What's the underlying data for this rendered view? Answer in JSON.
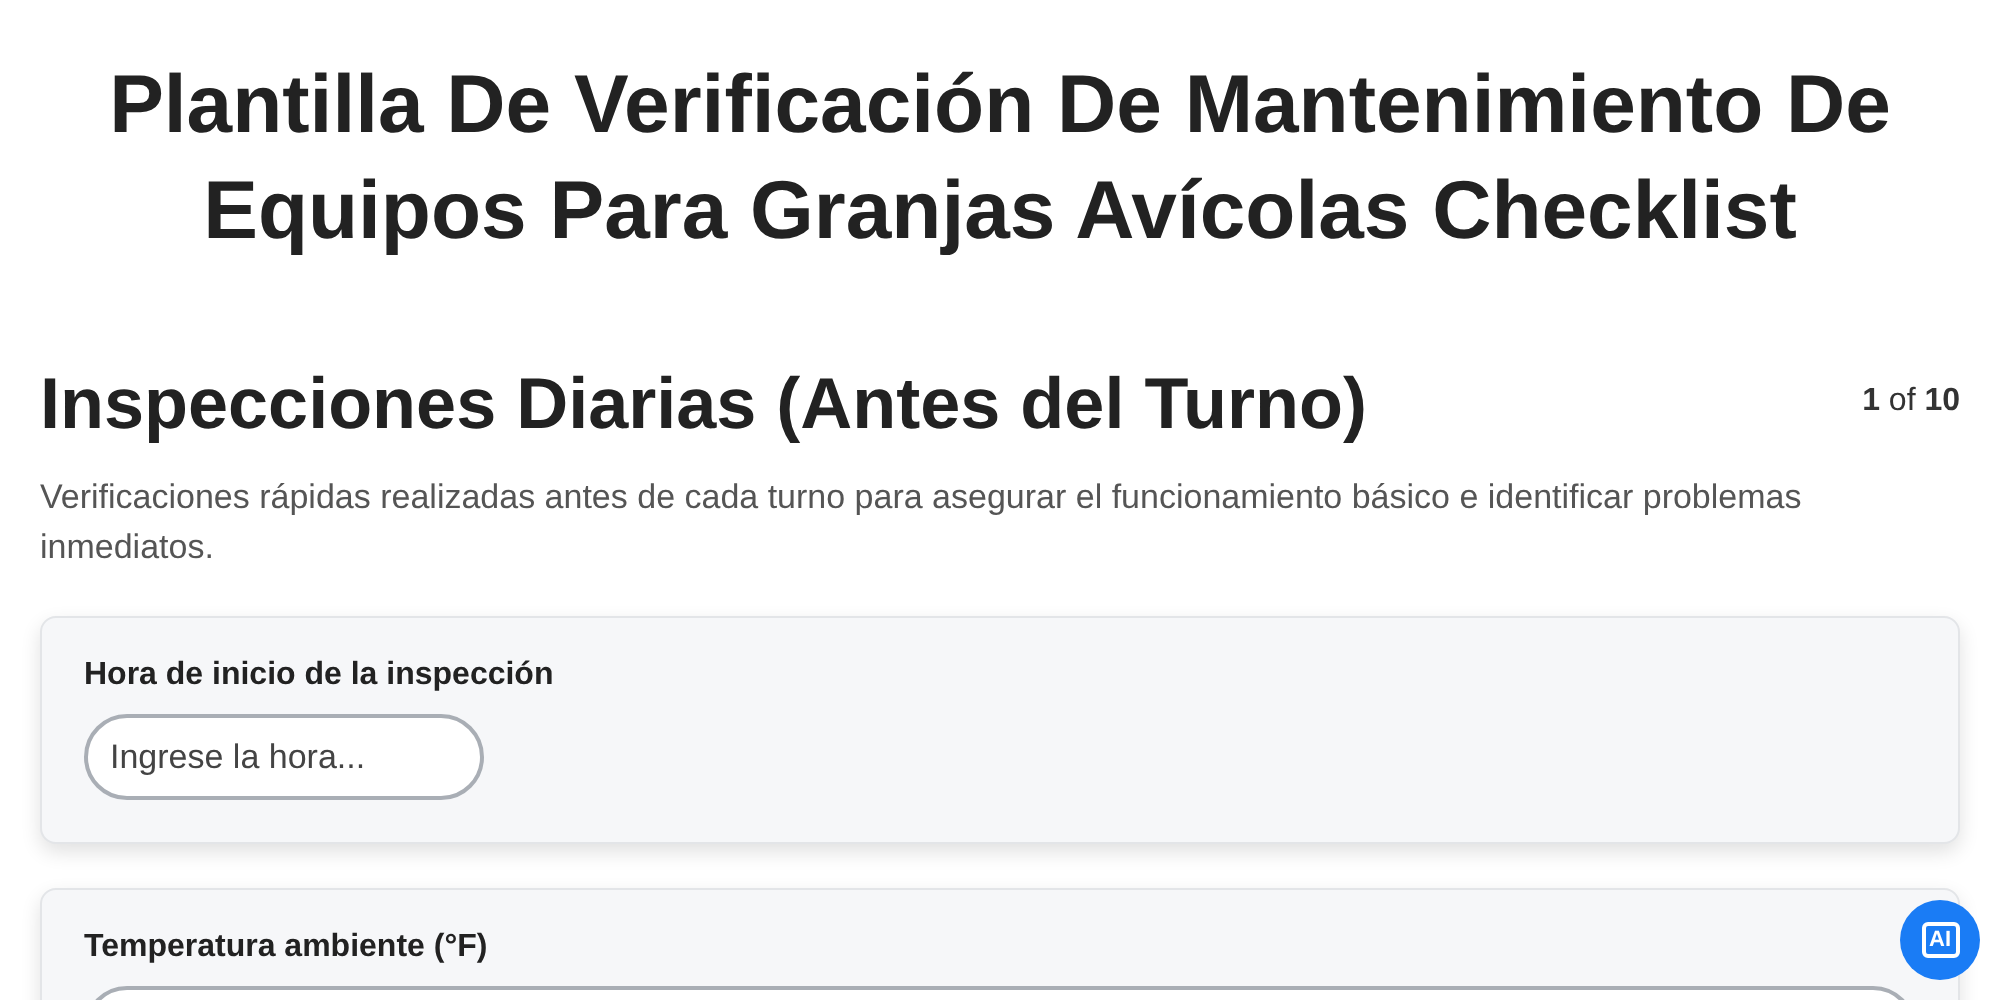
{
  "title": "Plantilla De Verificación De Mantenimiento De Equipos Para Granjas Avícolas Checklist",
  "section": {
    "heading": "Inspecciones Diarias (Antes del Turno)",
    "pager": "**1** of **10**",
    "description": "Verificaciones rápidas realizadas antes de cada turno para asegurar el funcionamiento básico e identificar problemas inmediatos."
  },
  "fields": [
    {
      "label": "Hora de inicio de la inspección",
      "placeholder": "Ingrese la hora...",
      "kind": "short"
    },
    {
      "label": "Temperatura ambiente (°F)",
      "kind": "wide"
    }
  ],
  "ai_button": {
    "label": "AI"
  }
}
